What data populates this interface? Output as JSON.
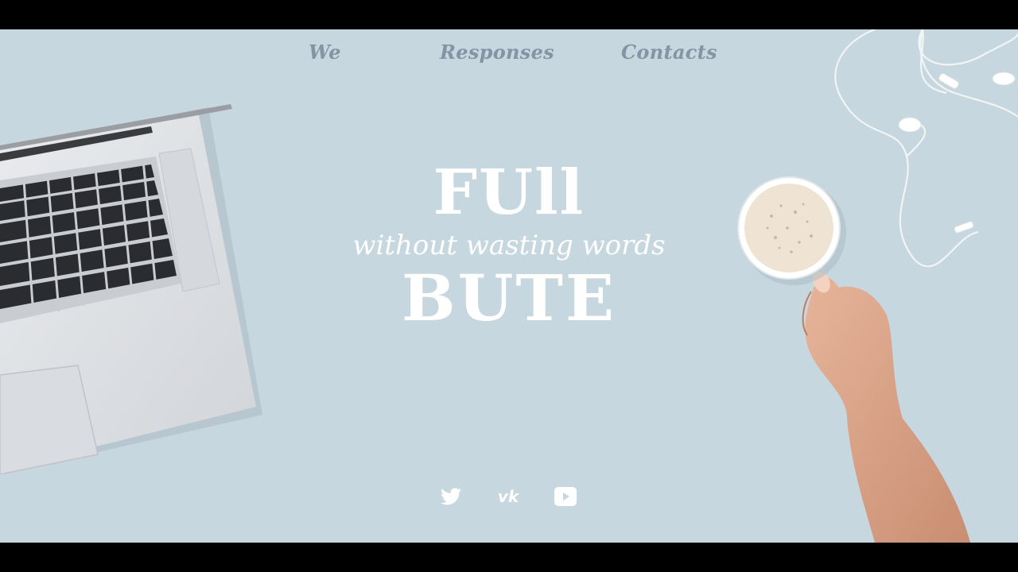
{
  "nav": {
    "items": [
      {
        "label": "We"
      },
      {
        "label": "Responses"
      },
      {
        "label": "Contacts"
      }
    ]
  },
  "hero": {
    "title_top": "FUll",
    "tagline": "without wasting words",
    "title_bottom": "BUTE"
  },
  "social": {
    "icons": [
      "twitter-icon",
      "vk-icon",
      "youtube-icon"
    ],
    "vk_glyph": "vk"
  },
  "colors": {
    "background": "#c7d7df",
    "nav_text": "#8494a3",
    "hero_text": "#ffffff",
    "letterbox": "#000000"
  }
}
